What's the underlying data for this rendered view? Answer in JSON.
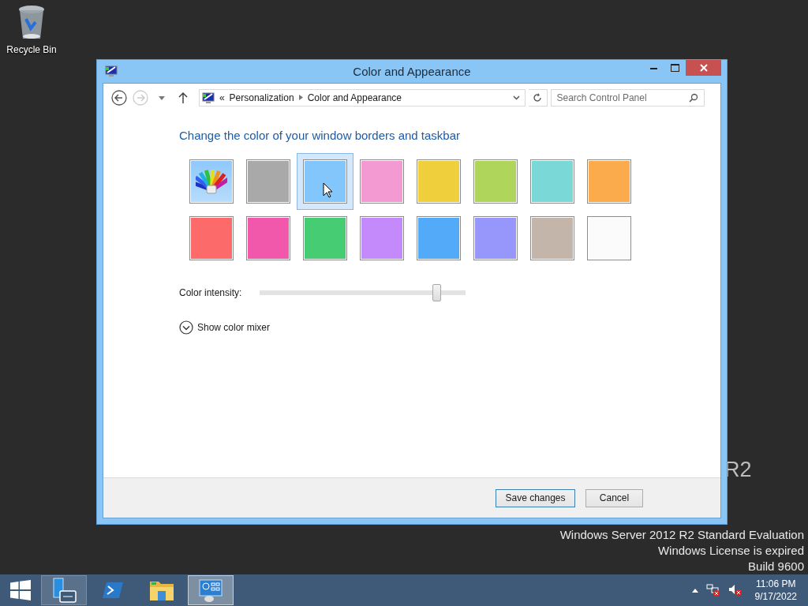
{
  "desktop_icons": [
    {
      "label": "Recycle Bin"
    }
  ],
  "window": {
    "title": "Color and Appearance"
  },
  "address": {
    "prefix": "«",
    "breadcrumb": [
      "Personalization",
      "Color and Appearance"
    ]
  },
  "search": {
    "placeholder": "Search Control Panel"
  },
  "heading": "Change the color of your window borders and taskbar",
  "swatches": [
    {
      "kind": "custom",
      "selected": false
    },
    {
      "kind": "color",
      "color": "#a9a9a9",
      "selected": false
    },
    {
      "kind": "color",
      "color": "#82c6fb",
      "selected": true
    },
    {
      "kind": "color",
      "color": "#f29ad1",
      "selected": false
    },
    {
      "kind": "color",
      "color": "#efd03c",
      "selected": false
    },
    {
      "kind": "color",
      "color": "#afd65a",
      "selected": false
    },
    {
      "kind": "color",
      "color": "#7ad8d6",
      "selected": false
    },
    {
      "kind": "color",
      "color": "#fcab4c",
      "selected": false
    },
    {
      "kind": "color",
      "color": "#fc6a6a",
      "selected": false
    },
    {
      "kind": "color",
      "color": "#f157aa",
      "selected": false
    },
    {
      "kind": "color",
      "color": "#46cd73",
      "selected": false
    },
    {
      "kind": "color",
      "color": "#c48afb",
      "selected": false
    },
    {
      "kind": "color",
      "color": "#53aaf8",
      "selected": false
    },
    {
      "kind": "color",
      "color": "#9696fb",
      "selected": false
    },
    {
      "kind": "color",
      "color": "#c3b5aa",
      "selected": false
    },
    {
      "kind": "color",
      "color": "#fbfbfb",
      "selected": false
    }
  ],
  "intensity": {
    "label": "Color intensity:",
    "level": 0.86
  },
  "mixer": {
    "label": "Show color mixer",
    "expanded": false
  },
  "buttons": [
    {
      "label": "Save changes",
      "default": true
    },
    {
      "label": "Cancel",
      "default": false
    }
  ],
  "desktop_text": {
    "logo_fragment": "R2",
    "lines": [
      "Windows Server 2012 R2 Standard Evaluation",
      "Windows License is expired",
      "Build 9600"
    ]
  },
  "taskbar": {
    "apps": [
      {
        "kind": "server-manager",
        "running": true,
        "active": false
      },
      {
        "kind": "powershell",
        "running": false,
        "active": false
      },
      {
        "kind": "explorer",
        "running": false,
        "active": false
      },
      {
        "kind": "control-panel",
        "running": true,
        "active": true
      }
    ],
    "clock": {
      "time": "11:06 PM",
      "date": "9/17/2022"
    }
  }
}
